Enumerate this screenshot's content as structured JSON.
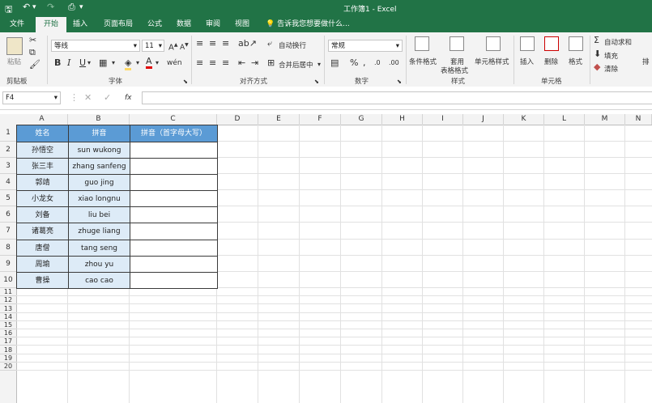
{
  "titlebar": {
    "title": "工作簿1 - Excel",
    "bg": "#217346"
  },
  "tabs": [
    {
      "label": "文件",
      "active": false
    },
    {
      "label": "开始",
      "active": true
    },
    {
      "label": "插入",
      "active": false
    },
    {
      "label": "页面布局",
      "active": false
    },
    {
      "label": "公式",
      "active": false
    },
    {
      "label": "数据",
      "active": false
    },
    {
      "label": "审阅",
      "active": false
    },
    {
      "label": "视图",
      "active": false
    }
  ],
  "tell_me": "告诉我您想要做什么...",
  "ribbon": {
    "clipboard": {
      "paste": "粘贴",
      "label": "剪贴板"
    },
    "font": {
      "name": "等线",
      "size": "11",
      "label": "字体"
    },
    "alignment": {
      "wrap": "自动换行",
      "merge": "合并后居中",
      "label": "对齐方式"
    },
    "number": {
      "format": "常规",
      "label": "数字"
    },
    "styles": {
      "conditional": "条件格式",
      "table": "套用",
      "table2": "表格格式",
      "cell_styles": "单元格样式",
      "label": "样式"
    },
    "cells": {
      "insert": "插入",
      "delete": "删除",
      "format": "格式",
      "label": "单元格"
    },
    "editing": {
      "autosum": "自动求和",
      "fill": "填充",
      "clear": "清除",
      "sort": "排"
    }
  },
  "formula_bar": {
    "name_box": "F4",
    "fx": "fx",
    "value": ""
  },
  "columns": [
    "A",
    "B",
    "C",
    "D",
    "E",
    "F",
    "G",
    "H",
    "I",
    "J",
    "K",
    "L",
    "M",
    "N"
  ],
  "rows": [
    "1",
    "2",
    "3",
    "4",
    "5",
    "6",
    "7",
    "8",
    "9",
    "10",
    "11",
    "12",
    "13",
    "14",
    "15",
    "16",
    "17",
    "18",
    "19",
    "20"
  ],
  "table": {
    "headers": [
      "姓名",
      "拼音",
      "拼音（首字母大写）"
    ],
    "header_bg": "#5b9bd5",
    "data_bg": "#ddebf7",
    "rows": [
      [
        "孙悟空",
        "sun wukong",
        ""
      ],
      [
        "张三丰",
        "zhang sanfeng",
        ""
      ],
      [
        "郭靖",
        "guo jing",
        ""
      ],
      [
        "小龙女",
        "xiao longnu",
        ""
      ],
      [
        "刘备",
        "liu bei",
        ""
      ],
      [
        "诸葛亮",
        "zhuge liang",
        ""
      ],
      [
        "唐僧",
        "tang seng",
        ""
      ],
      [
        "周瑜",
        "zhou yu",
        ""
      ],
      [
        "曹操",
        "cao cao",
        ""
      ]
    ]
  }
}
